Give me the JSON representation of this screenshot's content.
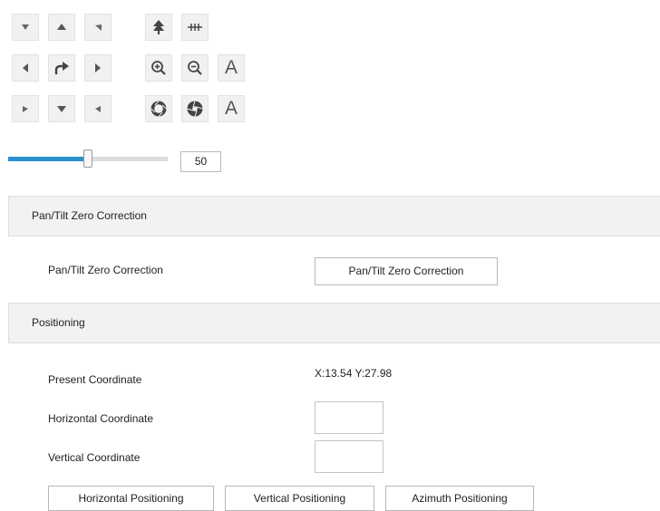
{
  "ptz": {
    "row1": [
      {
        "name": "pan-up-left-button",
        "icon": "arrow-up-left-icon"
      },
      {
        "name": "tilt-up-button",
        "icon": "arrow-up-icon"
      },
      {
        "name": "pan-up-right-button",
        "icon": "arrow-up-right-icon"
      },
      {
        "name": "wiper-button",
        "icon": "tree-icon"
      },
      {
        "name": "light-button",
        "icon": "heater-icon"
      }
    ],
    "row2": [
      {
        "name": "pan-left-button",
        "icon": "arrow-left-icon"
      },
      {
        "name": "auto-pan-button",
        "icon": "rotate-arrow-icon"
      },
      {
        "name": "pan-right-button",
        "icon": "arrow-right-icon"
      },
      {
        "name": "zoom-in-button",
        "icon": "zoom-in-icon"
      },
      {
        "name": "zoom-out-button",
        "icon": "zoom-out-icon"
      },
      {
        "name": "focus-auto-button",
        "label": "A"
      }
    ],
    "row3": [
      {
        "name": "pan-down-left-button",
        "icon": "arrow-down-left-icon"
      },
      {
        "name": "tilt-down-button",
        "icon": "arrow-down-icon"
      },
      {
        "name": "pan-down-right-button",
        "icon": "arrow-down-right-icon"
      },
      {
        "name": "iris-open-button",
        "icon": "iris-open-icon"
      },
      {
        "name": "iris-close-button",
        "icon": "iris-close-icon"
      },
      {
        "name": "iris-auto-button",
        "label": "A"
      }
    ]
  },
  "speed": {
    "value": "50",
    "fraction": 0.5
  },
  "zero_correction": {
    "header": "Pan/Tilt Zero Correction",
    "label": "Pan/Tilt Zero Correction",
    "button": "Pan/Tilt Zero Correction"
  },
  "positioning": {
    "header": "Positioning",
    "present_label": "Present Coordinate",
    "present_value": "X:13.54 Y:27.98",
    "horizontal_label": "Horizontal Coordinate",
    "horizontal_value": "",
    "vertical_label": "Vertical Coordinate",
    "vertical_value": "",
    "buttons": {
      "horizontal": "Horizontal Positioning",
      "vertical": "Vertical Positioning",
      "azimuth": "Azimuth Positioning"
    }
  }
}
